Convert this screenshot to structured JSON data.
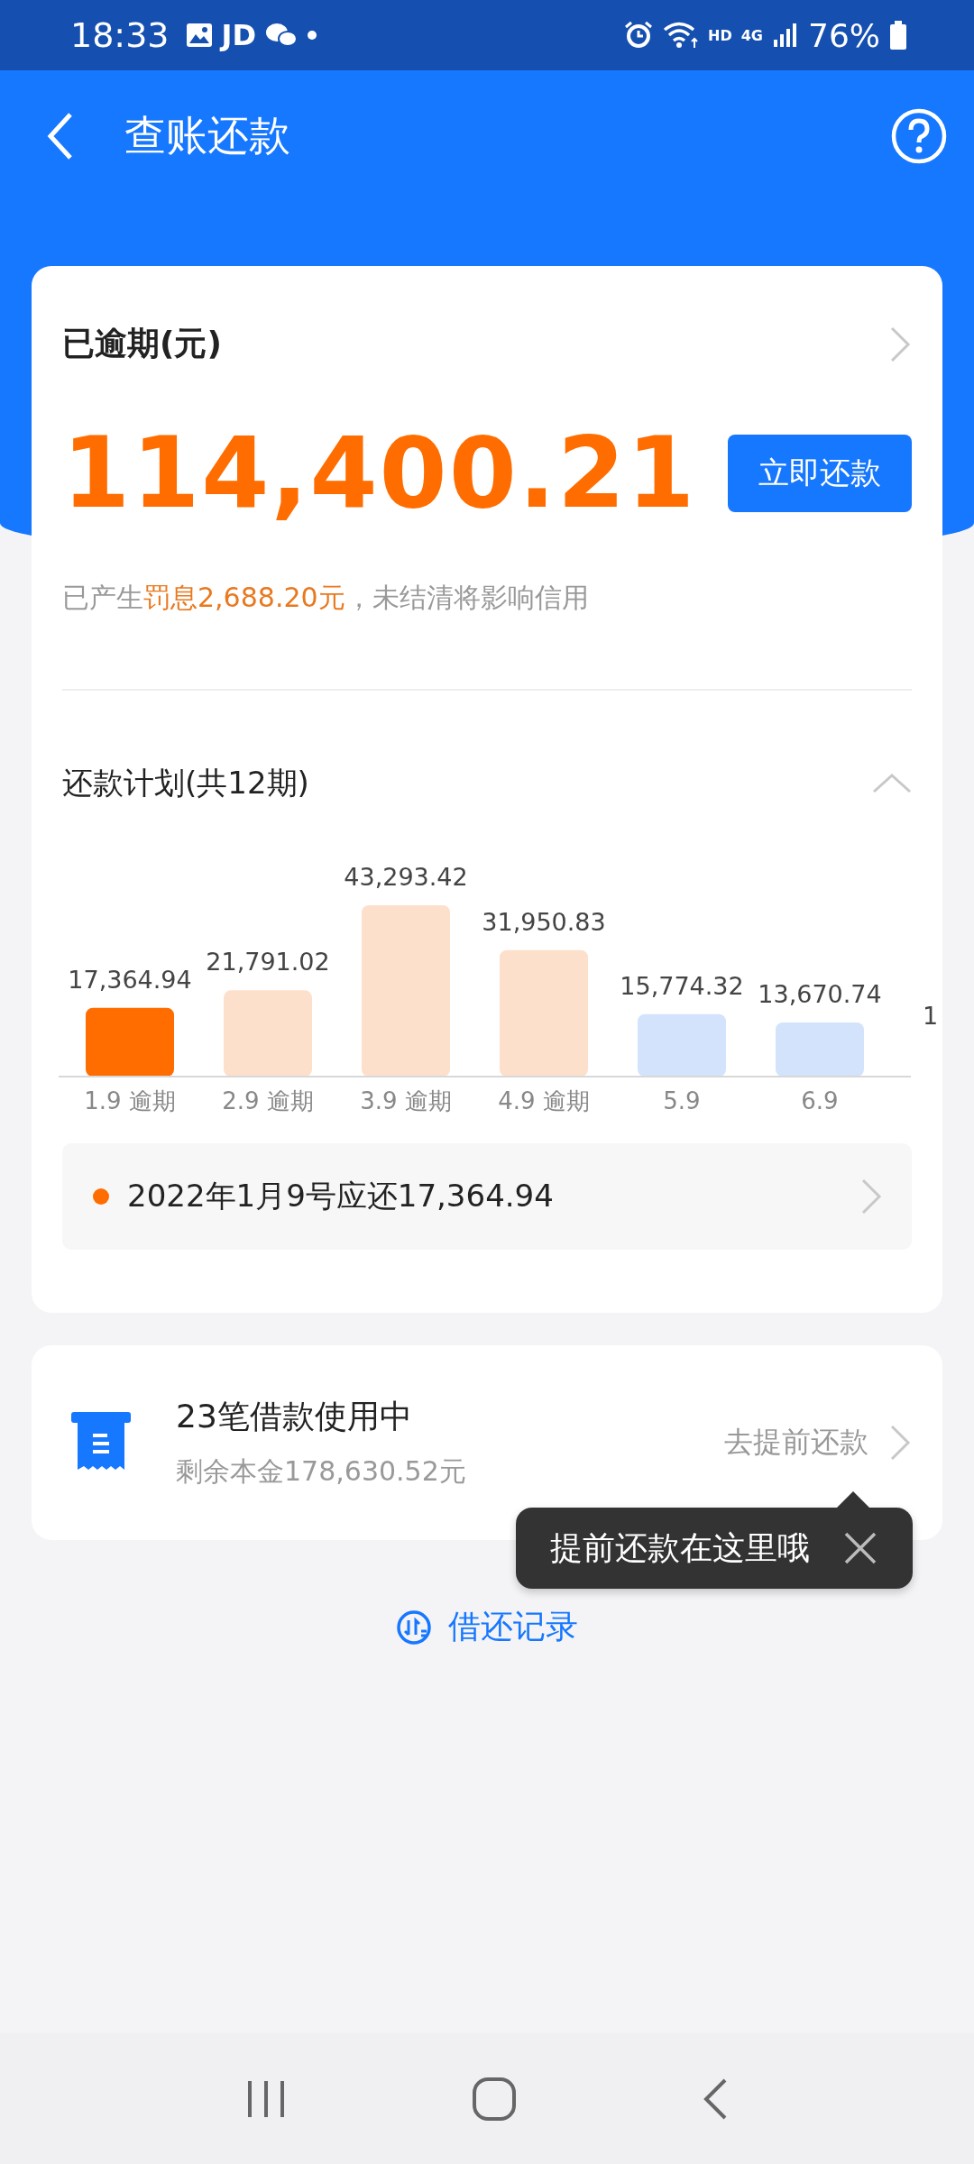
{
  "status_bar": {
    "time": "18:33",
    "notification_text": "JD",
    "hd": "HD",
    "network": "4G",
    "battery": "76%"
  },
  "app_bar": {
    "title": "查账还款"
  },
  "overdue_card": {
    "title": "已逾期(元)",
    "amount": "114,400.21",
    "pay_button": "立即还款",
    "penalty_note": "已产生**罚息2,688.20元**，未结清将影响信用",
    "plan_title": "还款计划(共12期)",
    "expanded": true,
    "chart_data": {
      "type": "bar",
      "categories": [
        "1.9 逾期",
        "2.9 逾期",
        "3.9 逾期",
        "4.9 逾期",
        "5.9",
        "6.9"
      ],
      "values": [
        17364.94,
        21791.02,
        43293.42,
        31950.83,
        15774.32,
        13670.74
      ],
      "value_labels": [
        "17,364.94",
        "21,791.02",
        "43,293.42",
        "31,950.83",
        "15,774.32",
        "13,670.74"
      ],
      "data_labels": true
    },
    "bars": [
      {
        "color": "#ff6d00"
      },
      {
        "color": "#fde0cb"
      },
      {
        "color": "#fde0cb"
      },
      {
        "color": "#fde0cb"
      },
      {
        "color": "#d3e3fc"
      },
      {
        "color": "#d3e3fc"
      }
    ],
    "chart_cut_label": "1",
    "due_note": {
      "color": "#ff6d00",
      "text": "2022年1月9号应还17,364.94"
    }
  },
  "loan_card": {
    "title": "23笔借款使用中",
    "remaining": "剩余本金178,630.52元",
    "action": "去提前还款"
  },
  "tooltip": {
    "text": "提前还款在这里哦"
  },
  "record_link": "借还记录"
}
